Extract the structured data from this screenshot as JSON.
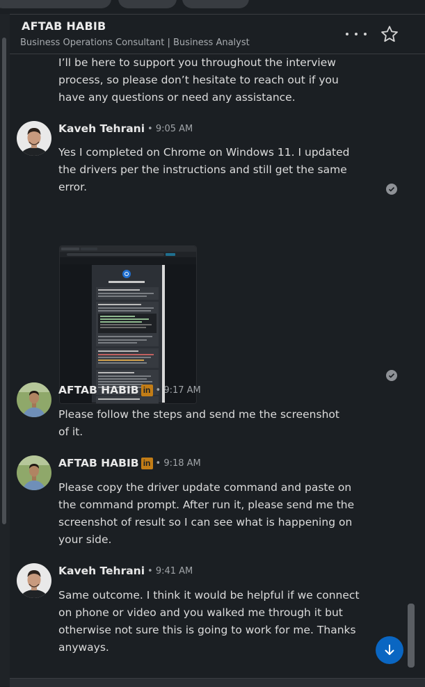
{
  "header": {
    "name": "AFTAB HABIB",
    "subtitle": "Business Operations Consultant | Business Analyst"
  },
  "messages": {
    "prev_text": "I’ll be here to support you throughout the interview process, so please don’t hesitate to reach out if you have any questions or need any assistance.",
    "m1": {
      "sender": "Kaveh Tehrani",
      "time": "• 9:05 AM",
      "text": "Yes I completed on Chrome on Windows 11. I updated the drivers per the instructions and still get the same error.",
      "attachment_title": "Frequently Asked Questions"
    },
    "m2": {
      "sender": "AFTAB HABIB",
      "badge": "in",
      "time": "• 9:17 AM",
      "text": "Please follow the steps and send me the screenshot of it."
    },
    "m3": {
      "sender": "AFTAB HABIB",
      "badge": "in",
      "time": "• 9:18 AM",
      "text": "Please copy the driver update command and paste on the command prompt. After run it, please send me the screenshot of result so I can see what is happening on your side."
    },
    "m4": {
      "sender": "Kaveh Tehrani",
      "time": "• 9:41 AM",
      "text": "Same outcome. I think it would be helpful if we connect on phone or video and you walked me through it but otherwise not sure this is going to work for me. Thanks anyways."
    }
  },
  "icons": {
    "more": "more-icon",
    "star": "star-icon",
    "seen": "read-receipt-icon",
    "scroll_down": "arrow-down-icon"
  },
  "colors": {
    "background": "#1b1f23",
    "accent": "#0a66c2",
    "linkedin_badge": "#c37d16"
  }
}
